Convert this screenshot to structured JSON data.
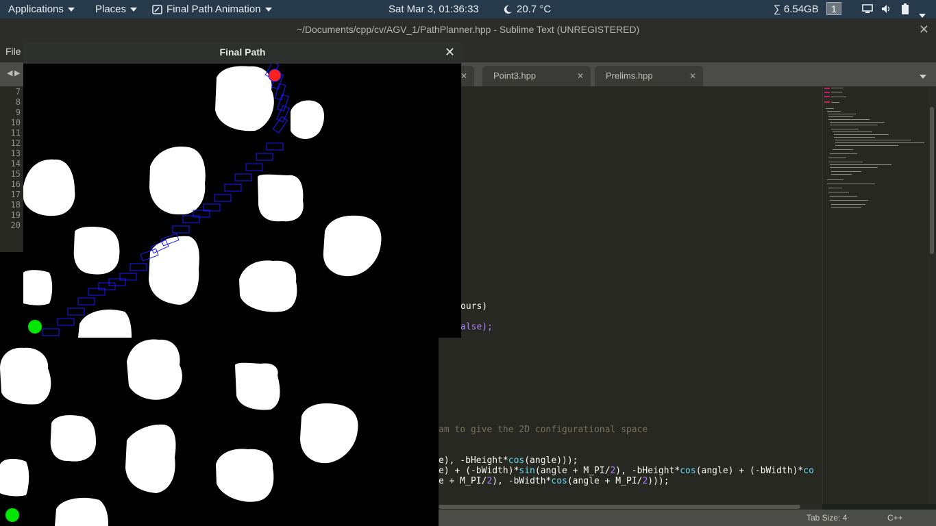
{
  "top_panel": {
    "applications_label": "Applications",
    "places_label": "Places",
    "active_app_label": "Final Path Animation",
    "clock": "Sat Mar  3, 01:36:33",
    "weather_temp": "20.7 °C",
    "memory": "∑ 6.54GB",
    "workspace": "1",
    "icons": [
      "moon-icon",
      "monitor-icon",
      "volume-icon",
      "battery-icon"
    ]
  },
  "sublime": {
    "title": "~/Documents/cpp/cv/AGV_1/PathPlanner.hpp - Sublime Text (UNREGISTERED)",
    "menu_file": "File",
    "tabs": [
      {
        "label": "Point3.hpp"
      },
      {
        "label": "Prelims.hpp"
      }
    ],
    "line_numbers": [
      "7",
      "8",
      "9",
      "10",
      "11",
      "12",
      "13",
      "14",
      "15",
      "16",
      "17",
      "18",
      "19",
      "20"
    ],
    "code_fragments": {
      "line_a": "ours)",
      "line_b": "alse);",
      "line_c": "am to give the 2D configurational space",
      "line_d1": "e), -bHeight*",
      "line_d2": "cos",
      "line_d3": "(angle)));",
      "line_e1": "e) + (-bWidth)*",
      "line_e2": "sin",
      "line_e3": "(angle + M_PI/",
      "line_e4": "2",
      "line_e5": "), -bHeight*",
      "line_e6": "cos",
      "line_e7": "(angle) + (-bWidth)*",
      "line_e8": "co",
      "line_f1": "e + M_PI/",
      "line_f2": "2",
      "line_f3": "), -bWidth*",
      "line_f4": "cos",
      "line_f5": "(angle + M_PI/",
      "line_f6": "2",
      "line_f7": ")));"
    },
    "status_tab_size": "Tab Size: 4",
    "status_syntax": "C++"
  },
  "final_path_window": {
    "title": "Final Path"
  },
  "colors": {
    "panel_bg": "#263a4c",
    "start_marker": "#00ff00",
    "goal_marker": "#ff2020",
    "path_boxes": "#1a1aff"
  }
}
